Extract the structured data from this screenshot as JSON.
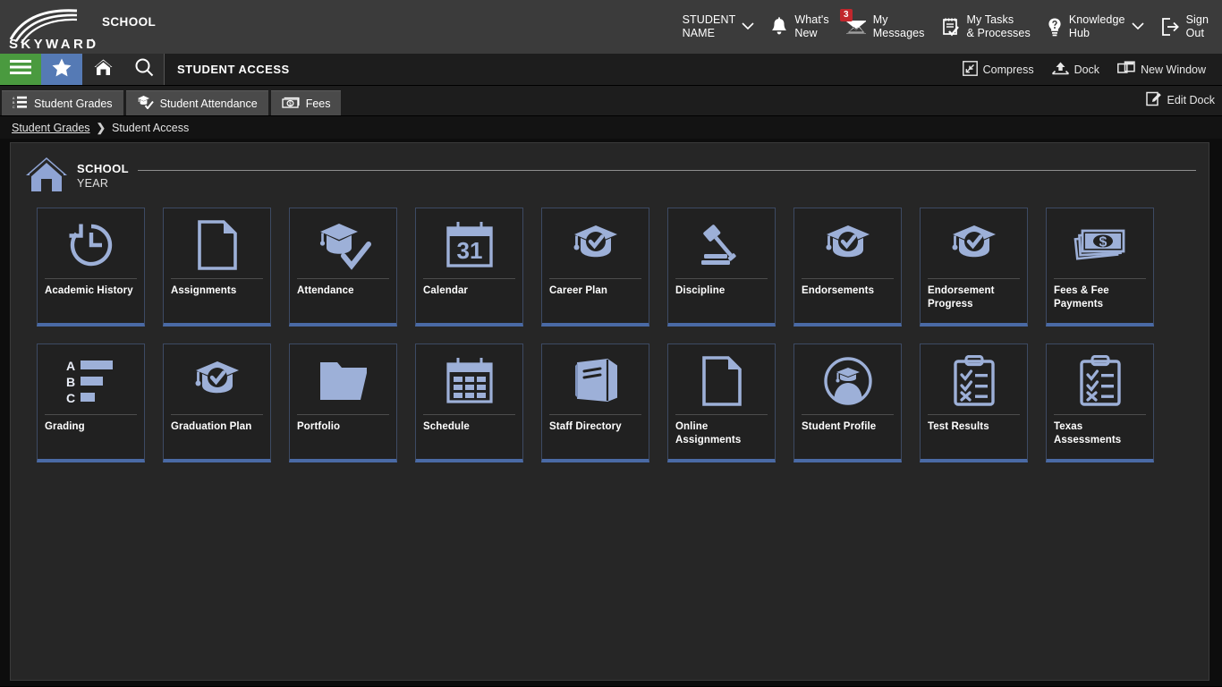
{
  "header": {
    "logo_text": "SKYWARD",
    "school": "SCHOOL",
    "items": [
      {
        "label": "STUDENT\nNAME",
        "icon": "chevron-down-icon",
        "has_caret": true
      },
      {
        "label": "What's\nNew",
        "icon": "bell-icon"
      },
      {
        "label": "My\nMessages",
        "icon": "envelope-icon",
        "badge": "3"
      },
      {
        "label": "My Tasks\n& Processes",
        "icon": "tasks-icon"
      },
      {
        "label": "Knowledge\nHub",
        "icon": "lightbulb-question-icon",
        "has_caret": true
      },
      {
        "label": "Sign\nOut",
        "icon": "sign-out-icon"
      }
    ]
  },
  "navbar": {
    "title": "STUDENT ACCESS",
    "buttons": [
      {
        "name": "menu",
        "icon": "hamburger-icon",
        "color": "#4a9a3f"
      },
      {
        "name": "favorites",
        "icon": "star-icon",
        "color": "#557ab5"
      },
      {
        "name": "home",
        "icon": "home-icon",
        "color": "#2c2c2c"
      },
      {
        "name": "search",
        "icon": "search-icon",
        "color": "#2c2c2c"
      }
    ],
    "actions": [
      {
        "label": "Compress",
        "icon": "compress-icon"
      },
      {
        "label": "Dock",
        "icon": "dock-icon"
      },
      {
        "label": "New Window",
        "icon": "new-window-icon"
      }
    ]
  },
  "tabbar": {
    "tabs": [
      {
        "label": "Student Grades",
        "icon": "grades-list-icon"
      },
      {
        "label": "Student Attendance",
        "icon": "attendance-icon"
      },
      {
        "label": "Fees",
        "icon": "money-icon"
      }
    ],
    "edit_dock_label": "Edit Dock",
    "edit_dock_icon": "edit-pencil-icon"
  },
  "breadcrumb": {
    "parent": "Student Grades",
    "separator": "❯",
    "current": "Student Access"
  },
  "school_header": {
    "icon": "house-icon",
    "name": "SCHOOL",
    "year": "YEAR"
  },
  "colors": {
    "accent_blue": "#4a6aa5",
    "icon_blue": "#9db0d8",
    "menu_green": "#4a9a3f",
    "star_blue": "#557ab5",
    "badge_red": "#c1272d",
    "panel_bg": "#262626",
    "tile_bg": "#212121"
  },
  "tiles": [
    {
      "label": "Academic History",
      "icon": "history-clock-icon"
    },
    {
      "label": "Assignments",
      "icon": "document-icon"
    },
    {
      "label": "Attendance",
      "icon": "graduate-check-icon"
    },
    {
      "label": "Calendar",
      "icon": "calendar-31-icon"
    },
    {
      "label": "Career Plan",
      "icon": "grad-cap-check-icon"
    },
    {
      "label": "Discipline",
      "icon": "gavel-icon"
    },
    {
      "label": "Endorsements",
      "icon": "grad-cap-check-icon"
    },
    {
      "label": "Endorsement Progress",
      "icon": "grad-cap-check-icon"
    },
    {
      "label": "Fees & Fee Payments",
      "icon": "money-stack-icon"
    },
    {
      "label": "Grading",
      "icon": "grade-bars-icon"
    },
    {
      "label": "Graduation Plan",
      "icon": "grad-cap-check-icon"
    },
    {
      "label": "Portfolio",
      "icon": "folder-icon"
    },
    {
      "label": "Schedule",
      "icon": "calendar-grid-icon"
    },
    {
      "label": "Staff Directory",
      "icon": "book-icon"
    },
    {
      "label": "Online Assignments",
      "icon": "document-icon"
    },
    {
      "label": "Student Profile",
      "icon": "student-avatar-icon"
    },
    {
      "label": "Test Results",
      "icon": "clipboard-check-icon"
    },
    {
      "label": "Texas Assessments",
      "icon": "clipboard-check-icon"
    }
  ]
}
